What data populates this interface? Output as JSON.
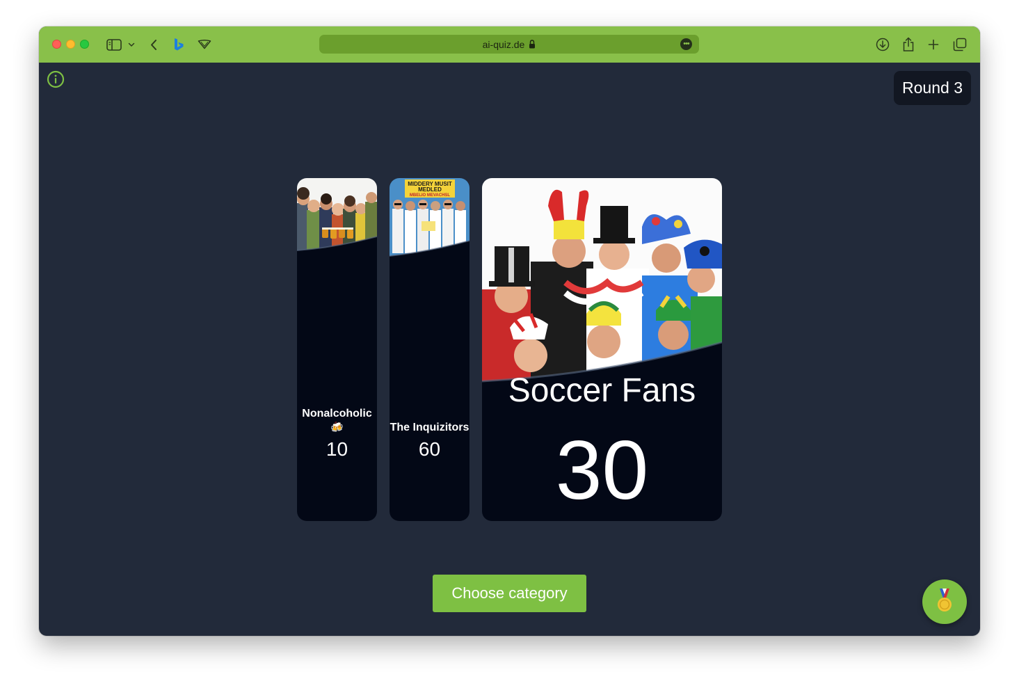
{
  "browser": {
    "url": "ai-quiz.de"
  },
  "game": {
    "round_label": "Round 3",
    "choose_label": "Choose category",
    "teams": [
      {
        "name": "Nonalcoholic",
        "emoji": "🍻",
        "score": "10"
      },
      {
        "name": "The Inquizitors",
        "score": "60"
      },
      {
        "name": "Soccer Fans",
        "score": "30"
      }
    ],
    "poster_lines": [
      "MIDDERY MUSIT",
      "MEDLED",
      "MBELIO MEVACHSL"
    ]
  },
  "colors": {
    "toolbar": "#89c04a",
    "address_bar": "#6b9f2d",
    "page_background": "#222a3a",
    "card_background": "#030816",
    "accent_button": "#7ec043"
  },
  "icons": {
    "info": "info-circle-icon",
    "medal": "medal-icon",
    "sidebar": "sidebar-icon",
    "back": "chevron-left-icon",
    "download": "download-icon",
    "share": "share-icon",
    "new_tab": "plus-icon",
    "tabs": "tab-overview-icon"
  }
}
